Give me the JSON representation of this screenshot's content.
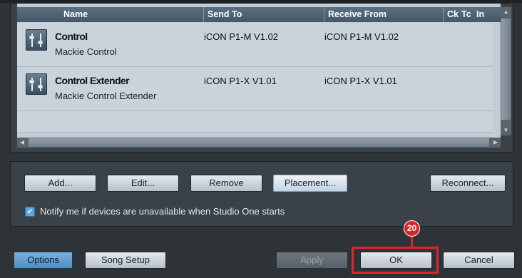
{
  "table": {
    "columns": [
      "Name",
      "Send To",
      "Receive From",
      "Ck",
      "Tc",
      "In"
    ],
    "rows": [
      {
        "name": "Control",
        "subtitle": "Mackie Control",
        "send_to": "iCON P1-M V1.02",
        "receive_from": "iCON P1-M V1.02",
        "icon": "fader-icon"
      },
      {
        "name": "Control Extender",
        "subtitle": "Mackie Control Extender",
        "send_to": "iCON P1-X V1.01",
        "receive_from": "iCON P1-X V1.01",
        "icon": "fader-icon"
      }
    ]
  },
  "actions": {
    "add": "Add...",
    "edit": "Edit...",
    "remove": "Remove",
    "placement": "Placement...",
    "reconnect": "Reconnect..."
  },
  "notify": {
    "checked": true,
    "label": "Notify me if devices are unavailable when Studio One starts"
  },
  "footer": {
    "options": "Options",
    "song_setup": "Song Setup",
    "apply": "Apply",
    "ok": "OK",
    "cancel": "Cancel"
  },
  "annotation": {
    "step_number": "20",
    "color": "#e0262b"
  },
  "colors": {
    "header_bg": "#4e6275",
    "row_bg": "#c8d3dc",
    "accent": "#5aa7e3"
  }
}
